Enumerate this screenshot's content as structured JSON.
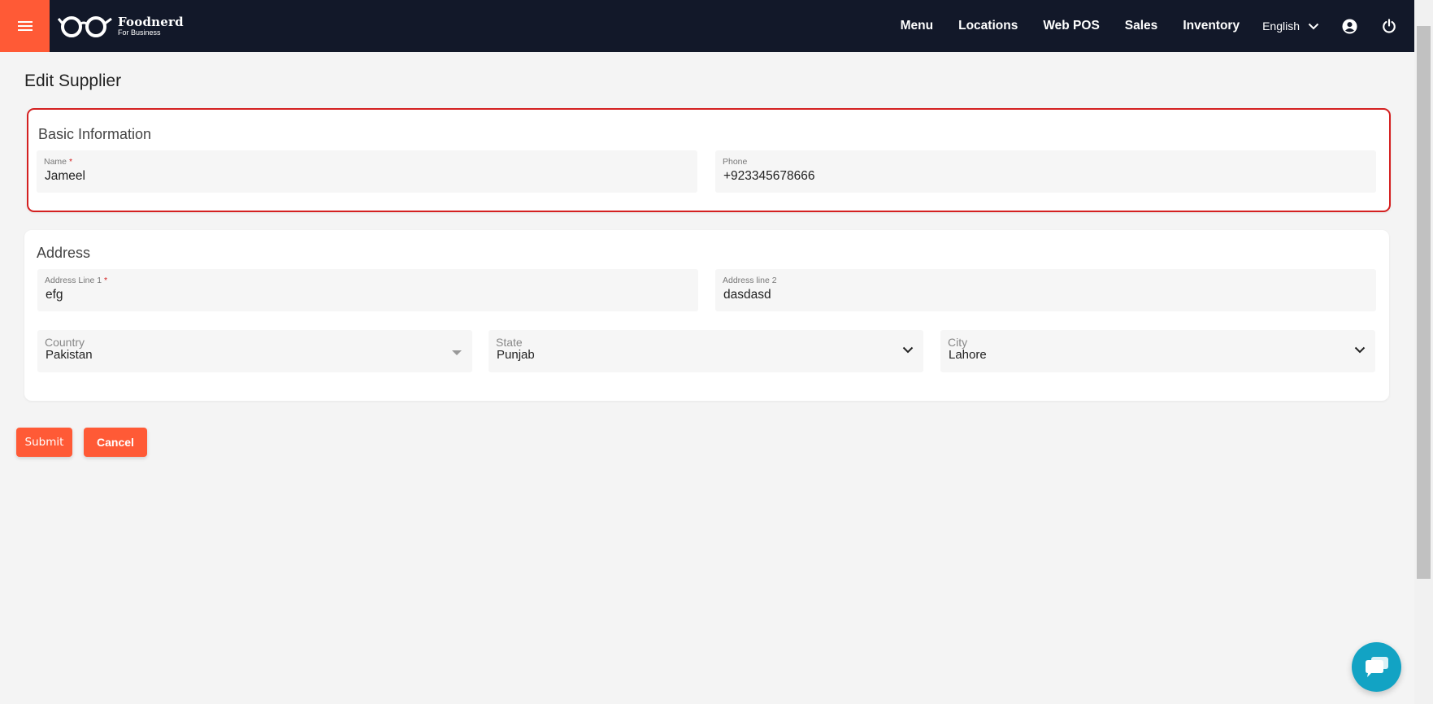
{
  "brand": {
    "name": "Foodnerd",
    "sub": "For Business"
  },
  "nav": {
    "items": [
      "Menu",
      "Locations",
      "Web POS",
      "Sales",
      "Inventory"
    ],
    "language": "English"
  },
  "page": {
    "title": "Edit Supplier"
  },
  "basic": {
    "title": "Basic Information",
    "name": {
      "label": "Name",
      "required": "*",
      "value": "Jameel"
    },
    "phone": {
      "label": "Phone",
      "value": "+923345678666"
    }
  },
  "address": {
    "title": "Address",
    "line1": {
      "label": "Address Line 1",
      "required": "*",
      "value": "efg"
    },
    "line2": {
      "label": "Address line 2",
      "value": "dasdasd"
    },
    "country": {
      "label": "Country",
      "value": "Pakistan"
    },
    "state": {
      "label": "State",
      "value": "Punjab"
    },
    "city": {
      "label": "City",
      "value": "Lahore"
    }
  },
  "actions": {
    "submit": "Submit",
    "cancel": "Cancel"
  },
  "colors": {
    "accent": "#ff5a36",
    "topbar": "#121829",
    "highlight": "#d42020",
    "chat": "#12a3c4"
  },
  "icons": [
    "hamburger-icon",
    "glasses-logo-icon",
    "chevron-down-icon",
    "account-icon",
    "power-icon",
    "chat-icon"
  ]
}
